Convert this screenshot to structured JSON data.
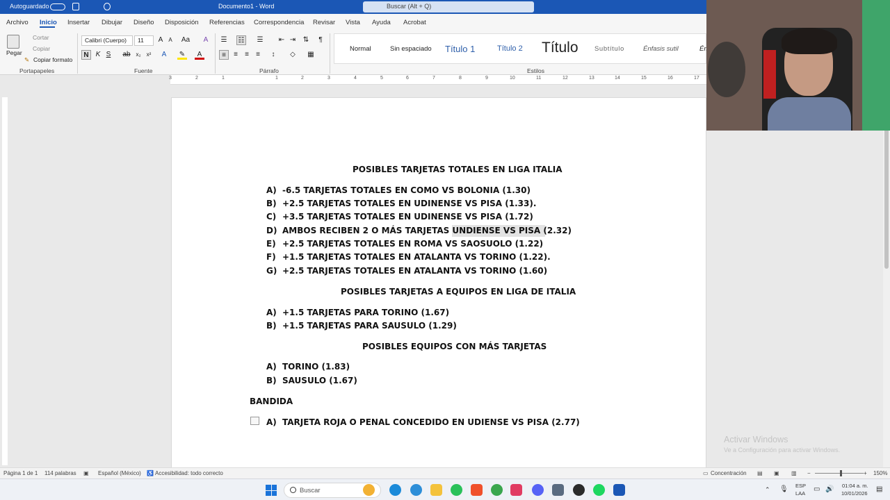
{
  "titlebar": {
    "autosave": "Autoguardado",
    "doc_title": "Documento1 - Word",
    "search_placeholder": "Buscar (Alt + Q)"
  },
  "menu": [
    "Archivo",
    "Inicio",
    "Insertar",
    "Dibujar",
    "Diseño",
    "Disposición",
    "Referencias",
    "Correspondencia",
    "Revisar",
    "Vista",
    "Ayuda",
    "Acrobat"
  ],
  "ribbon": {
    "clipboard": {
      "paste": "Pegar",
      "cut": "Cortar",
      "copy": "Copiar",
      "format_painter": "Copiar formato",
      "label": "Portapapeles"
    },
    "font": {
      "name": "Calibri (Cuerpo)",
      "size": "11",
      "label": "Fuente"
    },
    "paragraph": {
      "label": "Párrafo"
    },
    "styles": {
      "items": [
        "Normal",
        "Sin espaciado",
        "Título 1",
        "Título 2",
        "Título",
        "Subtítulo",
        "Énfasis sutil",
        "Én"
      ],
      "label": "Estilos"
    }
  },
  "ruler": [
    "3",
    "2",
    "1",
    "1",
    "2",
    "3",
    "4",
    "5",
    "6",
    "7",
    "8",
    "9",
    "10",
    "11",
    "12",
    "13",
    "14",
    "15",
    "16",
    "17"
  ],
  "document": {
    "heading1": "POSIBLES TARJETAS TOTALES EN LIGA ITALIA",
    "list1": [
      {
        "label": "A)",
        "text": "-6.5 TARJETAS TOTALES EN COMO VS BOLONIA (1.30)"
      },
      {
        "label": "B)",
        "text": "+2.5 TARJETAS TOTALES EN UDINENSE VS PISA (1.33)."
      },
      {
        "label": "C)",
        "text": "+3.5 TARJETAS TOTALES EN UDINENSE VS PISA (1.72)"
      },
      {
        "label": "D)",
        "text": "AMBOS RECIBEN 2 O MÁS TARJETAS UNDIENSE VS PISA (2.32)"
      },
      {
        "label": "E)",
        "text": "+2.5 TARJETAS TOTALES EN ROMA VS SAOSUOLO (1.22)"
      },
      {
        "label": "F)",
        "text": "+1.5 TARJETAS TOTALES EN ATALANTA VS TORINO (1.22)."
      },
      {
        "label": "G)",
        "text": "+2.5 TARJETAS TOTALES EN ATALANTA VS TORINO (1.60)"
      }
    ],
    "heading2": "POSIBLES TARJETAS A EQUIPOS EN LIGA DE ITALIA",
    "list2": [
      {
        "label": "A)",
        "text": "+1.5 TARJETAS PARA TORINO (1.67)"
      },
      {
        "label": "B)",
        "text": "+1.5 TARJETAS PARA SAUSULO (1.29)"
      }
    ],
    "heading3": "POSIBLES EQUIPOS CON MÁS TARJETAS",
    "list3": [
      {
        "label": "A)",
        "text": "TORINO (1.83)"
      },
      {
        "label": "B)",
        "text": "SAUSULO (1.67)"
      }
    ],
    "heading4": "BANDIDA",
    "list4": [
      {
        "label": "A)",
        "text": "TARJETA ROJA O PENAL CONCEDIDO EN UDIENSE VS PISA (2.77)"
      }
    ]
  },
  "watermark": {
    "title": "Activar Windows",
    "subtitle": "Ve a Configuración para activar Windows."
  },
  "statusbar": {
    "page": "Página 1 de 1",
    "words": "114 palabras",
    "language": "Español (México)",
    "accessibility": "Accesibilidad: todo correcto",
    "focus": "Concentración",
    "zoom": "150%"
  },
  "taskbar": {
    "search": "Buscar",
    "lang": "ESP",
    "region": "LAA",
    "time": "01:04 a. m.",
    "date": "10/01/2026"
  },
  "colors": {
    "word_blue": "#1b57b5",
    "page": "#ffffff",
    "canvas": "#e9e9e9"
  }
}
